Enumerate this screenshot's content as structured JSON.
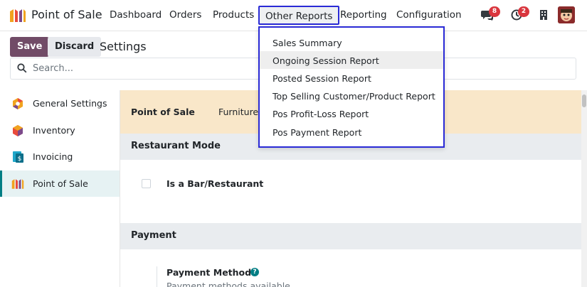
{
  "app": {
    "title": "Point of Sale"
  },
  "nav": {
    "items": [
      "Dashboard",
      "Orders",
      "Products",
      "Other Reports",
      "Reporting",
      "Configuration"
    ]
  },
  "systray": {
    "messages_badge": "8",
    "activity_badge": "2"
  },
  "toolbar": {
    "save_label": "Save",
    "discard_label": "Discard",
    "title": "Settings"
  },
  "search": {
    "placeholder": "Search..."
  },
  "sidebar": {
    "items": [
      {
        "label": "General Settings",
        "icon": "settings-hex-icon"
      },
      {
        "label": "Inventory",
        "icon": "inventory-box-icon"
      },
      {
        "label": "Invoicing",
        "icon": "invoicing-icon"
      },
      {
        "label": "Point of Sale",
        "icon": "pos-store-icon"
      }
    ]
  },
  "main": {
    "app_header": {
      "name": "Point of Sale",
      "pos_name": "Furniture"
    },
    "sections": {
      "restaurant": {
        "title": "Restaurant Mode",
        "setting_label": "Is a Bar/Restaurant"
      },
      "payment": {
        "title": "Payment",
        "setting_label": "Payment Methods",
        "setting_desc": "Payment methods available"
      }
    }
  },
  "dropdown": {
    "items": [
      "Sales Summary",
      "Ongoing Session Report",
      "Posted Session Report",
      "Top Selling Customer/Product Report",
      "Pos Profit-Loss Report",
      "Pos Payment Report"
    ]
  },
  "colors": {
    "brand": "#714b67",
    "accent": "#017e84",
    "highlight_border": "#2a2ad6",
    "header_bg": "#f9e7c9",
    "badge": "#d9363e"
  }
}
